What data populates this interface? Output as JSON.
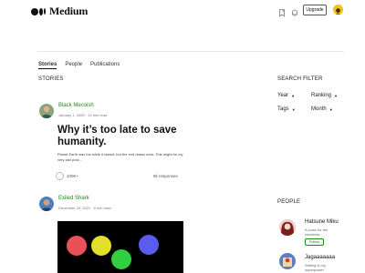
{
  "header": {
    "logo_text": "Medium",
    "icons": [
      "bookmark-icon",
      "bell-icon"
    ],
    "upgrade_label": "Upgrade",
    "accent_color": "#1a8917"
  },
  "tabs": [
    {
      "label": "Stories",
      "active": true
    },
    {
      "label": "People",
      "active": false
    },
    {
      "label": "Publications",
      "active": false
    }
  ],
  "stories_heading": "STORIES",
  "stories": [
    {
      "author": "Black Mecoish",
      "date": "January 1, 2050",
      "read_time": "10 min read",
      "title": "Why it’s too late to save humanity.",
      "subtitle": "Planet Earth was fun while it lasted, but the end draws near. This might be my very last post...",
      "claps": "100K+",
      "responses": "9k responses"
    },
    {
      "author": "Exiled Shark",
      "date": "December 25, 2021",
      "read_time": "6 min read",
      "image_dot_colors": [
        "#e9515a",
        "#e2e02a",
        "#2fcf3f",
        "#5a5cf0"
      ]
    }
  ],
  "search_filter": {
    "heading": "SEARCH FILTER",
    "filters": [
      "Year",
      "Ranking",
      "Tags",
      "Month"
    ]
  },
  "people": {
    "heading": "PEOPLE",
    "items": [
      {
        "name": "Hatsune Miku",
        "bio": "A voice for the voiceless",
        "follow_label": "Follow"
      },
      {
        "name": "Jagaaaaaaa",
        "bio": "Writing is my superpower"
      }
    ]
  }
}
